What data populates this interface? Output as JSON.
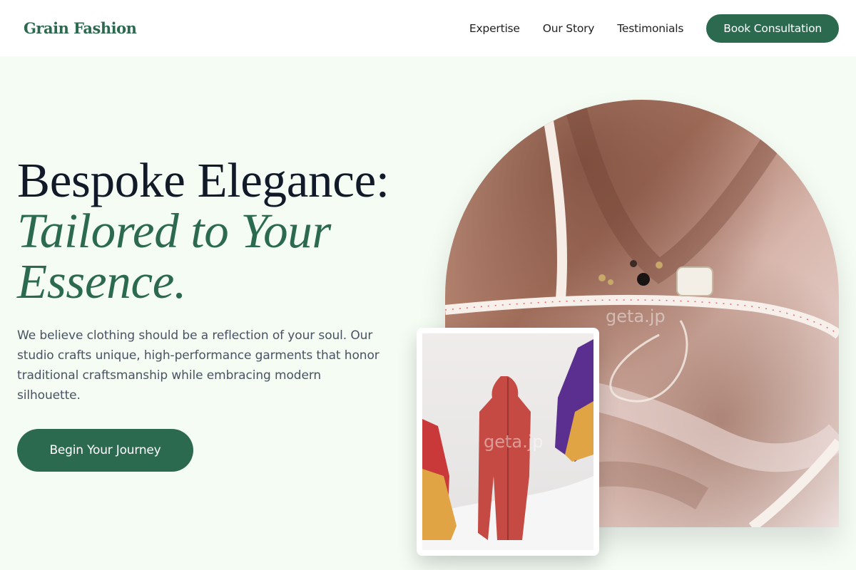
{
  "nav": {
    "brand": "Grain Fashion",
    "links": [
      "Expertise",
      "Our Story",
      "Testimonials"
    ],
    "cta_label": "Book Consultation"
  },
  "hero": {
    "headline_line1": "Bespoke Elegance:",
    "headline_accent": "Tailored to Your Essence.",
    "lead": "We believe clothing should be a reflection of your soul. Our studio crafts unique, high-performance garments that honor traditional craftsmanship while embracing modern silhouette.",
    "cta_label": "Begin Your Journey"
  },
  "images": {
    "main_watermark": "geta.jp",
    "card_watermark": "geta.jp"
  },
  "colors": {
    "brand_green": "#2c6a50",
    "page_background": "#f4fcf4",
    "headline": "#121a2a",
    "body_text": "#4a5262"
  }
}
